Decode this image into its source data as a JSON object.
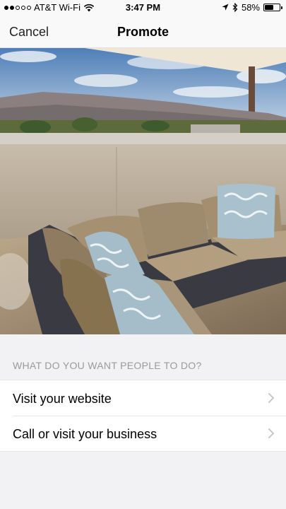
{
  "status_bar": {
    "carrier": "AT&T Wi-Fi",
    "time": "3:47 PM",
    "battery": "58%",
    "battery_level": 0.58
  },
  "nav": {
    "cancel_label": "Cancel",
    "title": "Promote"
  },
  "prompt": "WHAT DO YOU WANT PEOPLE TO DO?",
  "options": [
    {
      "label": "Visit your website",
      "icon": "chevron-right-icon"
    },
    {
      "label": "Call or visit your business",
      "icon": "chevron-right-icon"
    }
  ],
  "colors": {
    "background": "#f2f2f4",
    "secondary_text": "#9a9a9e",
    "chevron": "#c7c7cc"
  }
}
